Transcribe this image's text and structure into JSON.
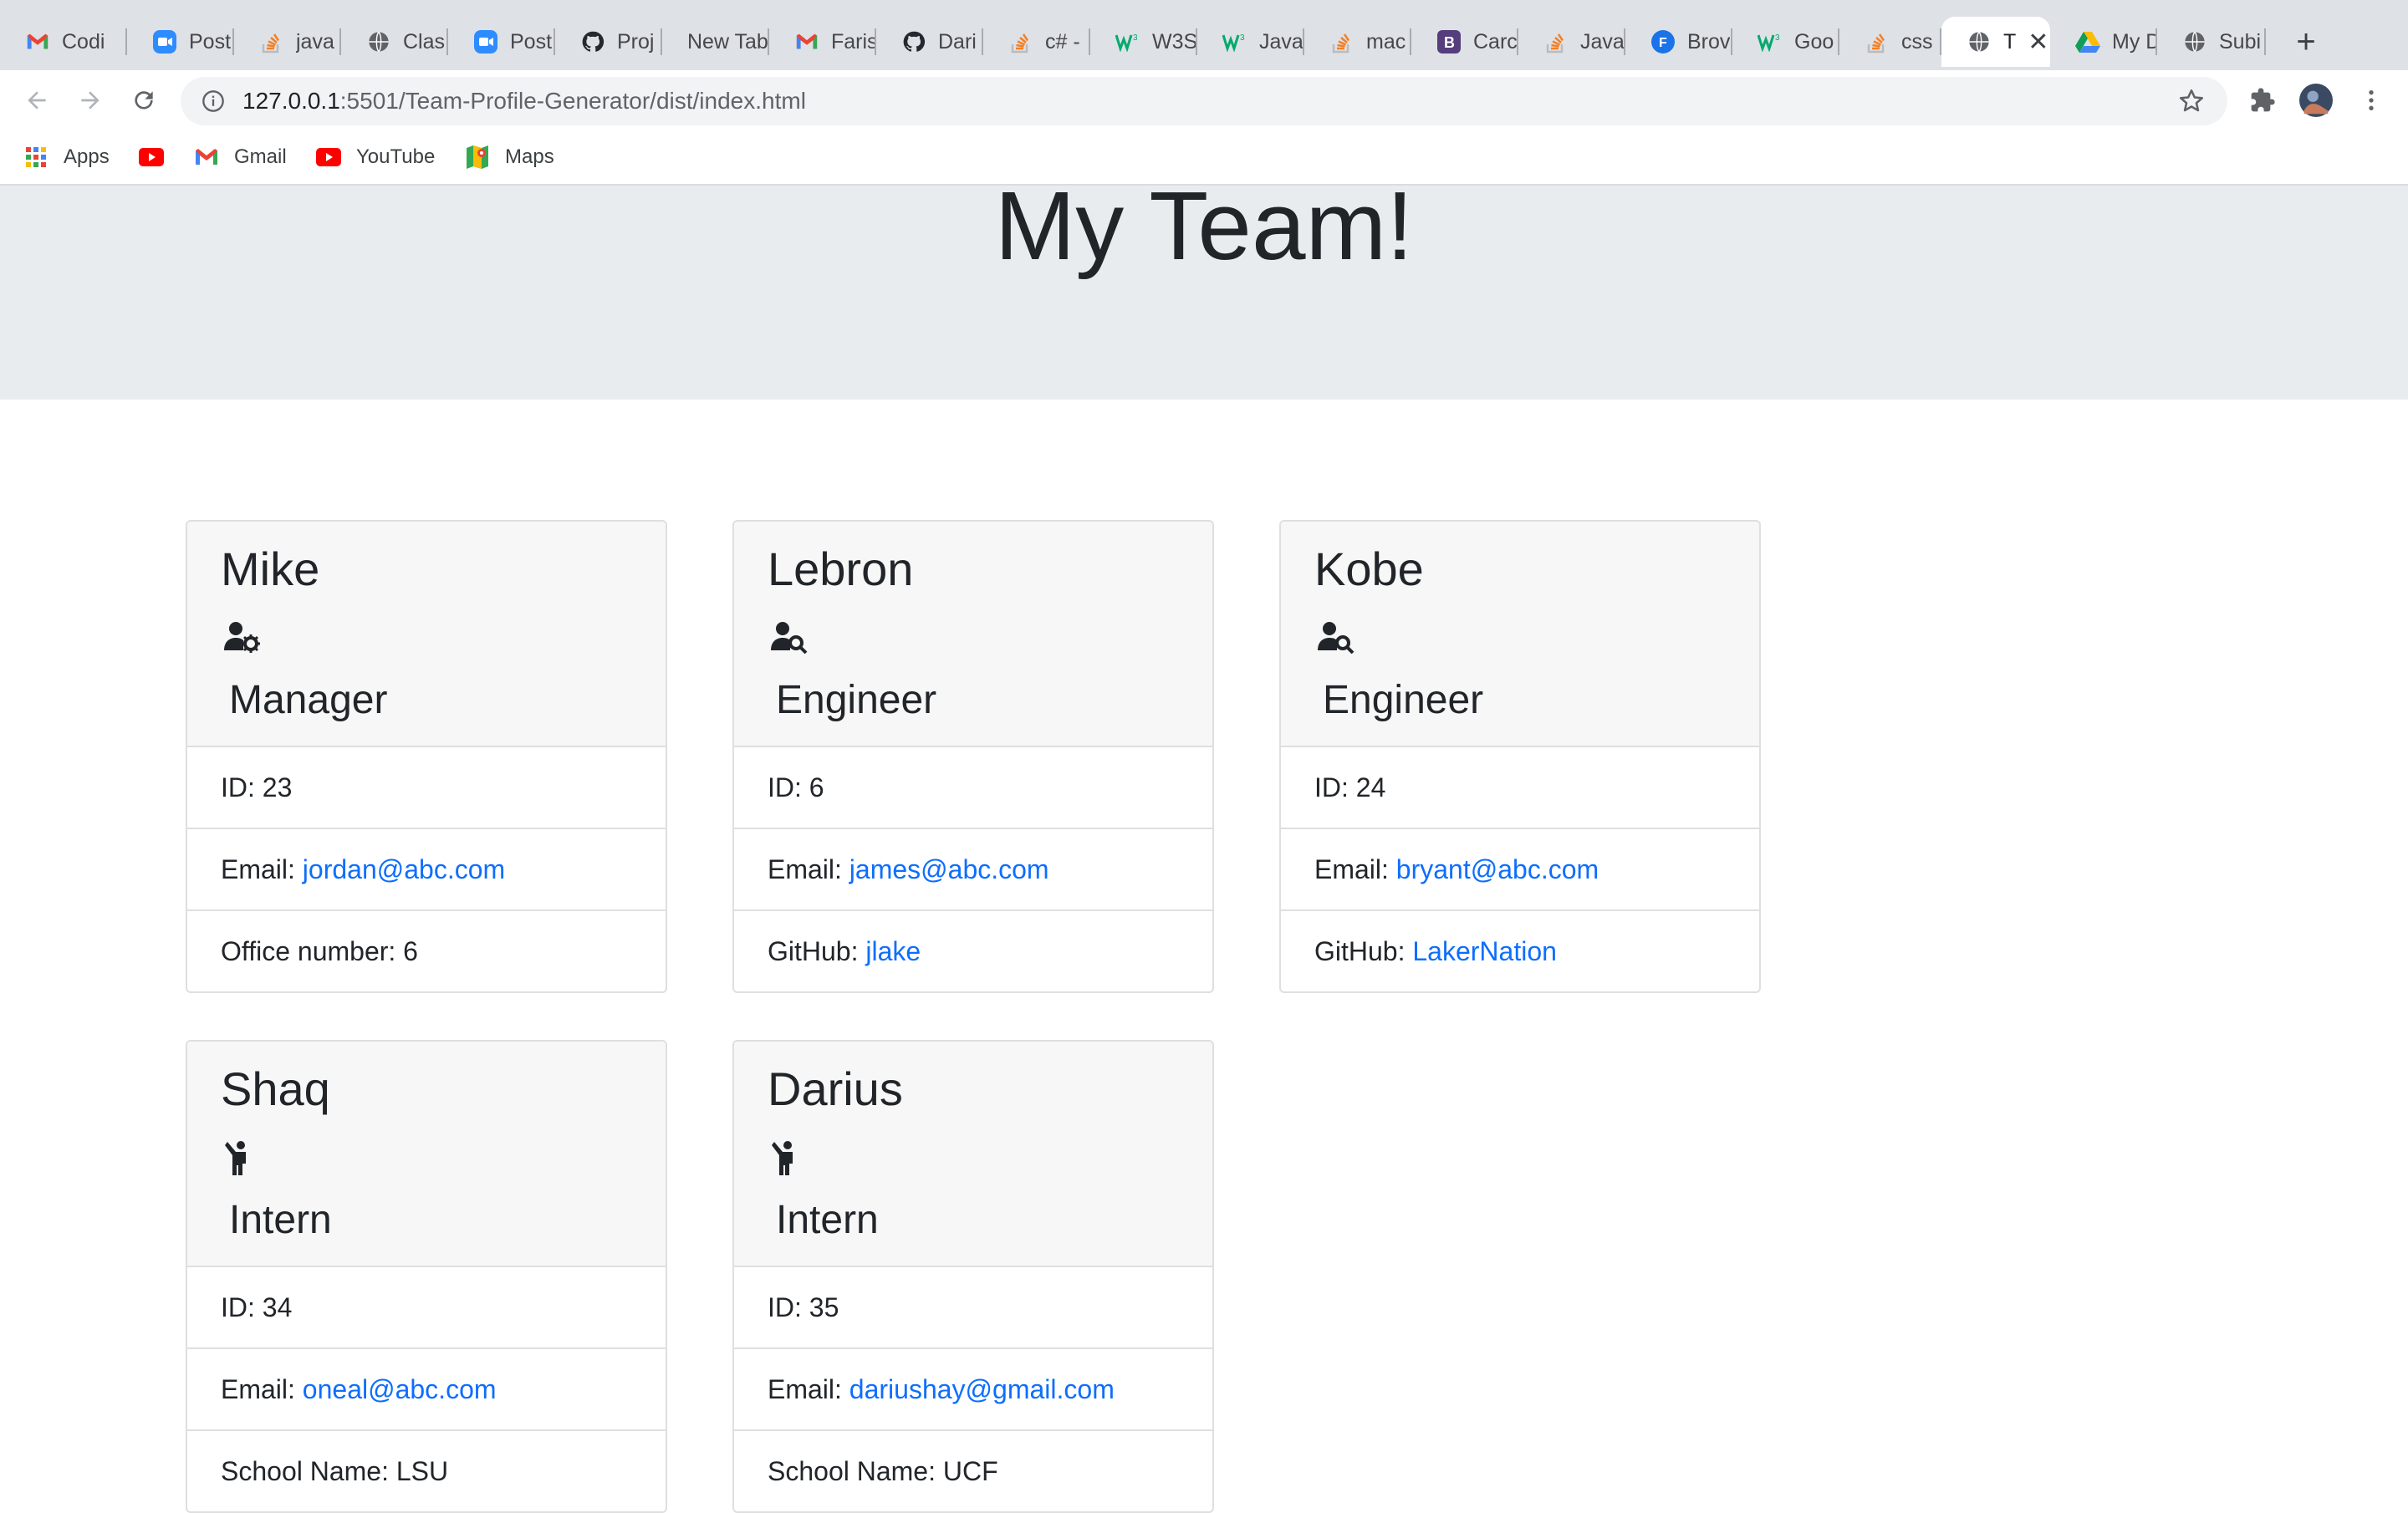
{
  "browser": {
    "tabs": [
      {
        "label": "Codi",
        "icon": "gmail-icon"
      },
      {
        "label": "Post",
        "icon": "zoom-icon"
      },
      {
        "label": "java",
        "icon": "stackoverflow-icon"
      },
      {
        "label": "Clas",
        "icon": "globe-icon"
      },
      {
        "label": "Post",
        "icon": "zoom-icon"
      },
      {
        "label": "Proj",
        "icon": "github-icon"
      },
      {
        "label": "New Tab",
        "icon": ""
      },
      {
        "label": "Faris",
        "icon": "gmail-icon"
      },
      {
        "label": "Dari",
        "icon": "github-icon"
      },
      {
        "label": "c# -",
        "icon": "stackoverflow-icon"
      },
      {
        "label": "W3S",
        "icon": "w3schools-icon"
      },
      {
        "label": "Java",
        "icon": "w3schools-icon"
      },
      {
        "label": "mac",
        "icon": "stackoverflow-icon"
      },
      {
        "label": "Carc",
        "icon": "bootstrap-icon"
      },
      {
        "label": "Java",
        "icon": "stackoverflow-icon"
      },
      {
        "label": "Brov",
        "icon": "f-icon"
      },
      {
        "label": "Goo",
        "icon": "w3schools-icon"
      },
      {
        "label": "css",
        "icon": "stackoverflow-icon"
      },
      {
        "label": "T",
        "icon": "globe-icon",
        "active": true
      },
      {
        "label": "My D",
        "icon": "drive-icon"
      },
      {
        "label": "Subi",
        "icon": "globe-icon"
      }
    ],
    "url_host": "127.0.0.1",
    "url_rest": ":5501/Team-Profile-Generator/dist/index.html",
    "bookmarks": [
      {
        "label": "Apps",
        "icon": "apps-grid-icon"
      },
      {
        "label": "",
        "icon": "youtube-icon"
      },
      {
        "label": "Gmail",
        "icon": "gmail-icon"
      },
      {
        "label": "YouTube",
        "icon": "youtube-icon"
      },
      {
        "label": "Maps",
        "icon": "maps-icon"
      }
    ]
  },
  "page": {
    "title": "My Team!",
    "cards": [
      {
        "name": "Mike",
        "role": "Manager",
        "role_icon": "user-gear-icon",
        "id_label": "ID: ",
        "id": "23",
        "email_label": "Email: ",
        "email": "jordan@abc.com",
        "extra_label": "Office number: ",
        "extra": "6",
        "extra_is_link": false
      },
      {
        "name": "Lebron",
        "role": "Engineer",
        "role_icon": "user-search-icon",
        "id_label": "ID: ",
        "id": "6",
        "email_label": "Email: ",
        "email": "james@abc.com",
        "extra_label": "GitHub: ",
        "extra": "jlake",
        "extra_is_link": true
      },
      {
        "name": "Kobe",
        "role": "Engineer",
        "role_icon": "user-search-icon",
        "id_label": "ID: ",
        "id": "24",
        "email_label": "Email: ",
        "email": "bryant@abc.com",
        "extra_label": "GitHub: ",
        "extra": "LakerNation",
        "extra_is_link": true
      },
      {
        "name": "Shaq",
        "role": "Intern",
        "role_icon": "child-icon",
        "id_label": "ID: ",
        "id": "34",
        "email_label": "Email: ",
        "email": "oneal@abc.com",
        "extra_label": "School Name: ",
        "extra": "LSU",
        "extra_is_link": false
      },
      {
        "name": "Darius",
        "role": "Intern",
        "role_icon": "child-icon",
        "id_label": "ID: ",
        "id": "35",
        "email_label": "Email: ",
        "email": "dariushay@gmail.com",
        "extra_label": "School Name: ",
        "extra": "UCF",
        "extra_is_link": false
      }
    ]
  },
  "colors": {
    "link": "#0d6efd",
    "jumbotron": "#e9ecef",
    "card_header": "#f7f7f7"
  }
}
